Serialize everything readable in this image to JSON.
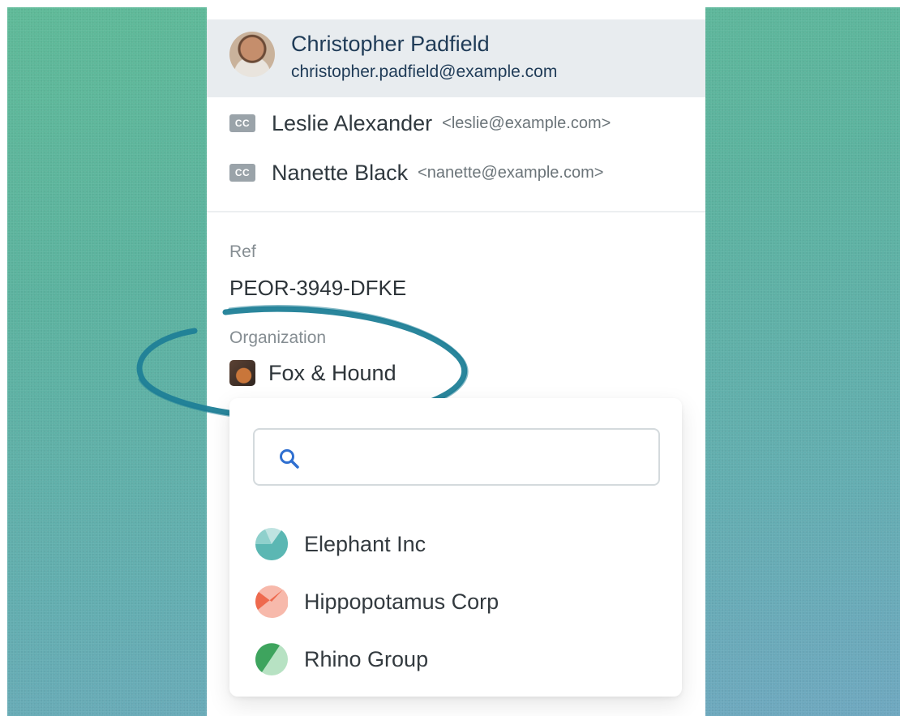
{
  "selected_contact": {
    "name": "Christopher Padfield",
    "email": "christopher.padfield@example.com"
  },
  "cc_list": [
    {
      "badge": "CC",
      "name": "Leslie Alexander",
      "email": "<leslie@example.com>"
    },
    {
      "badge": "CC",
      "name": "Nanette Black",
      "email": "<nanette@example.com>"
    }
  ],
  "ref": {
    "label": "Ref",
    "value": "PEOR-3949-DFKE"
  },
  "organization": {
    "label": "Organization",
    "value": "Fox & Hound"
  },
  "dropdown": {
    "search_placeholder": "",
    "options": [
      {
        "label": "Elephant Inc",
        "icon": "elephant-logo-icon",
        "colors": [
          "#5bb7b3",
          "#bfe3e1"
        ]
      },
      {
        "label": "Hippopotamus Corp",
        "icon": "hippo-logo-icon",
        "colors": [
          "#ee6a4e",
          "#f7b9ab"
        ]
      },
      {
        "label": "Rhino Group",
        "icon": "rhino-logo-icon",
        "colors": [
          "#3ea45e",
          "#b7e2c3"
        ]
      }
    ]
  },
  "annotation_color": "#1f7f97"
}
